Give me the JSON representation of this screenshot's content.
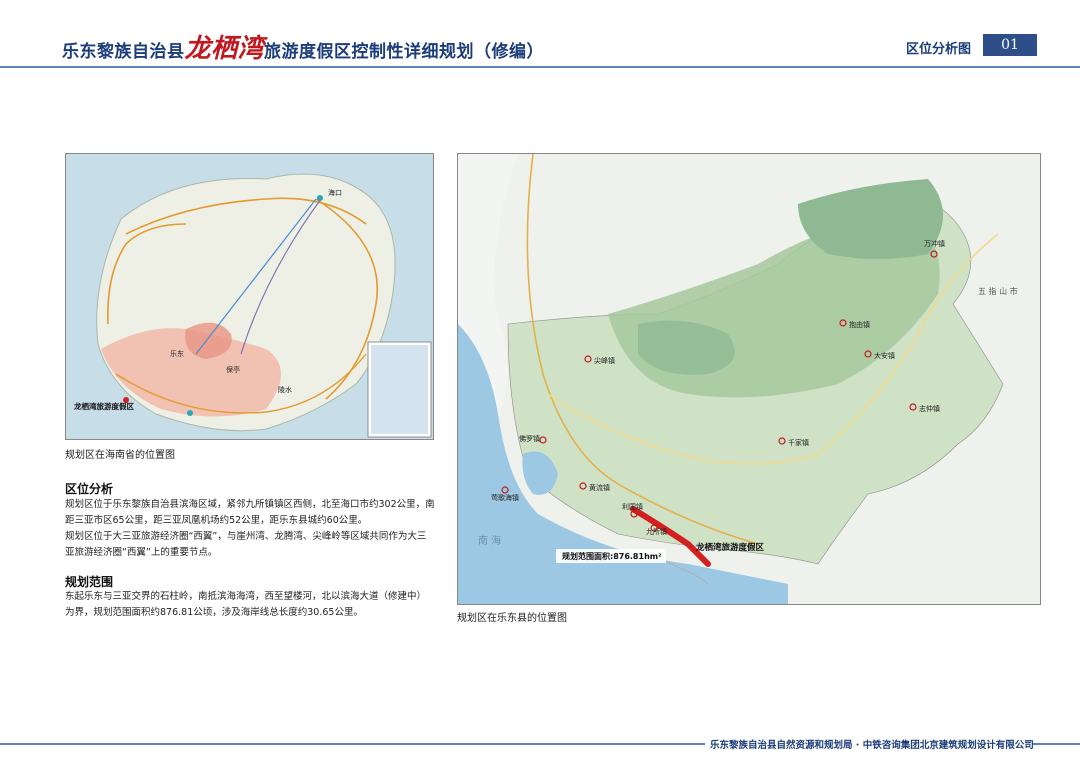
{
  "header": {
    "title_before": "乐东黎族自治县",
    "title_highlight": "龙栖湾",
    "title_after": "旅游度假区控制性详细规划（修编）",
    "section_label": "区位分析图",
    "page_number": "01"
  },
  "map1": {
    "caption": "规划区在海南省的位置图",
    "place_labels": [
      "海口",
      "乐东",
      "保亭",
      "陵水",
      "龙栖湾旅游度假区"
    ],
    "highlight_label": "龙栖湾旅游度假区"
  },
  "map2": {
    "caption": "规划区在乐东县的位置图",
    "towns": [
      "抱由镇",
      "万冲镇",
      "大安镇",
      "志仲镇",
      "千家镇",
      "尖峰镇",
      "佛罗镇",
      "黄流镇",
      "利国镇",
      "九所镇",
      "莺歌海镇"
    ],
    "sea_label": "南    海",
    "mountain_label": "五  指  山  市",
    "site_label": "龙栖湾旅游度假区",
    "area_label": "规划范围面积:876.81hm²"
  },
  "analysis": {
    "heading": "区位分析",
    "paragraph1": "规划区位于乐东黎族自治县滨海区域，紧邻九所镇镇区西侧，北至海口市约302公里，南距三亚市区65公里，距三亚凤凰机场约52公里，距乐东县城约60公里。",
    "paragraph2": "规划区位于大三亚旅游经济圈“西翼”，与崖州湾、龙腾湾、尖峰岭等区域共同作为大三亚旅游经济圈“西翼”上的重要节点。"
  },
  "scope": {
    "heading": "规划范围",
    "paragraph": "东起乐东与三亚交界的石柱岭，南抵滨海海湾，西至望楼河，北以滨海大道（修建中）为界，规划范围面积约876.81公顷，涉及海岸线总长度约30.65公里。"
  },
  "footer": {
    "text": "乐东黎族自治县自然资源和规划局 · 中铁咨询集团北京建筑规划设计有限公司"
  },
  "colors": {
    "title_blue": "#1c3d7a",
    "highlight_red": "#c0191f",
    "sea_blue": "#c7dde8",
    "terrain_green": "#8fb992",
    "site_red": "#d31f1f"
  }
}
